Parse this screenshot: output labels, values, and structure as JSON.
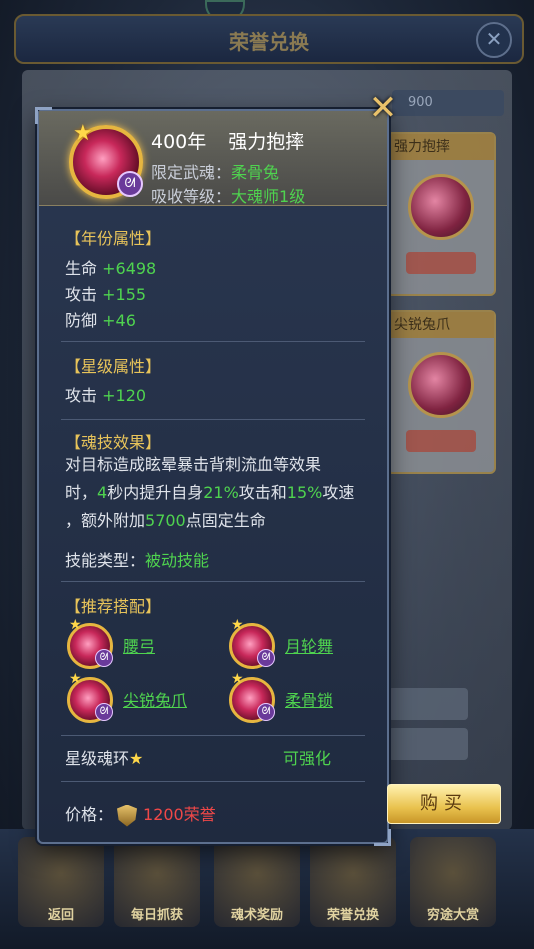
{
  "background": {
    "title": "荣誉兑换",
    "search_value": "900",
    "side_cards": [
      "强力抱摔",
      "尖锐兔爪"
    ],
    "bottom_tabs": [
      "返回",
      "每日抓获",
      "魂术奖励",
      "荣誉兑换",
      "穷途大赏"
    ]
  },
  "item": {
    "year": "400年",
    "name": "强力抱摔",
    "weapon_label": "限定武魂：",
    "weapon_value": "柔骨兔",
    "level_label": "吸收等级：",
    "level_value": "大魂师1级"
  },
  "year_attrs": {
    "header": "【年份属性】",
    "rows": [
      {
        "label": "生命",
        "value": "+6498"
      },
      {
        "label": "攻击",
        "value": "+155"
      },
      {
        "label": "防御",
        "value": "+46"
      }
    ]
  },
  "star_attrs": {
    "header": "【星级属性】",
    "rows": [
      {
        "label": "攻击",
        "value": "+120"
      }
    ]
  },
  "skill": {
    "header": "【魂技效果】",
    "line1": "对目标造成眩晕暴击背刺流血等效果",
    "line2_a": "时，",
    "line2_n1": "4",
    "line2_b": "秒内提升自身",
    "line2_n2": "21%",
    "line2_c": "攻击和",
    "line2_n3": "15%",
    "line2_d": "攻速",
    "line3_a": "，额外附加",
    "line3_n": "5700",
    "line3_b": "点固定生命",
    "type_label": "技能类型：",
    "type_value": "被动技能"
  },
  "recommend": {
    "header": "【推荐搭配】",
    "items": [
      "腰弓",
      "月轮舞",
      "尖锐兔爪",
      "柔骨锁"
    ]
  },
  "star_ring": {
    "label": "星级魂环",
    "status": "可强化"
  },
  "price": {
    "label": "价格：",
    "value": "1200荣誉"
  },
  "buy_label": "购买",
  "icons": {
    "close": "close-icon",
    "star": "star-icon",
    "rabbit": "rabbit-badge-icon",
    "honor": "honor-shield-icon"
  }
}
